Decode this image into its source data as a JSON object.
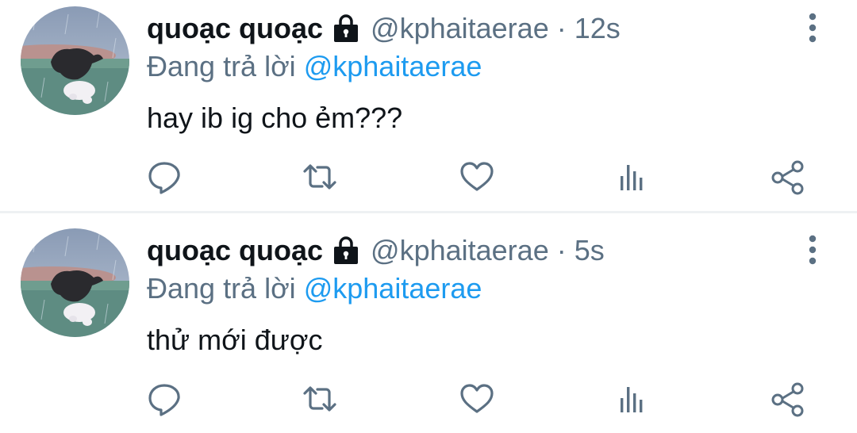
{
  "colors": {
    "text_primary": "#0f1419",
    "text_secondary": "#5b7083",
    "link": "#1d9bf0",
    "divider": "#eef1f3",
    "icon": "#5b7083"
  },
  "tweets": [
    {
      "display_name": "quoạc quoạc",
      "protected_icon": "lock-icon",
      "handle": "@kphaitaerae",
      "separator": "·",
      "time": "12s",
      "reply_prefix": "Đang trả lời",
      "reply_to": "@kphaitaerae",
      "text": "hay ib ig cho ẻm???",
      "actions": [
        "reply-icon",
        "retweet-icon",
        "like-icon",
        "stats-icon",
        "share-icon"
      ],
      "more_icon": "more-vertical-icon"
    },
    {
      "display_name": "quoạc quoạc",
      "protected_icon": "lock-icon",
      "handle": "@kphaitaerae",
      "separator": "·",
      "time": "5s",
      "reply_prefix": "Đang trả lời",
      "reply_to": "@kphaitaerae",
      "text": "thử mới được",
      "actions": [
        "reply-icon",
        "retweet-icon",
        "like-icon",
        "stats-icon",
        "share-icon"
      ],
      "more_icon": "more-vertical-icon"
    }
  ]
}
